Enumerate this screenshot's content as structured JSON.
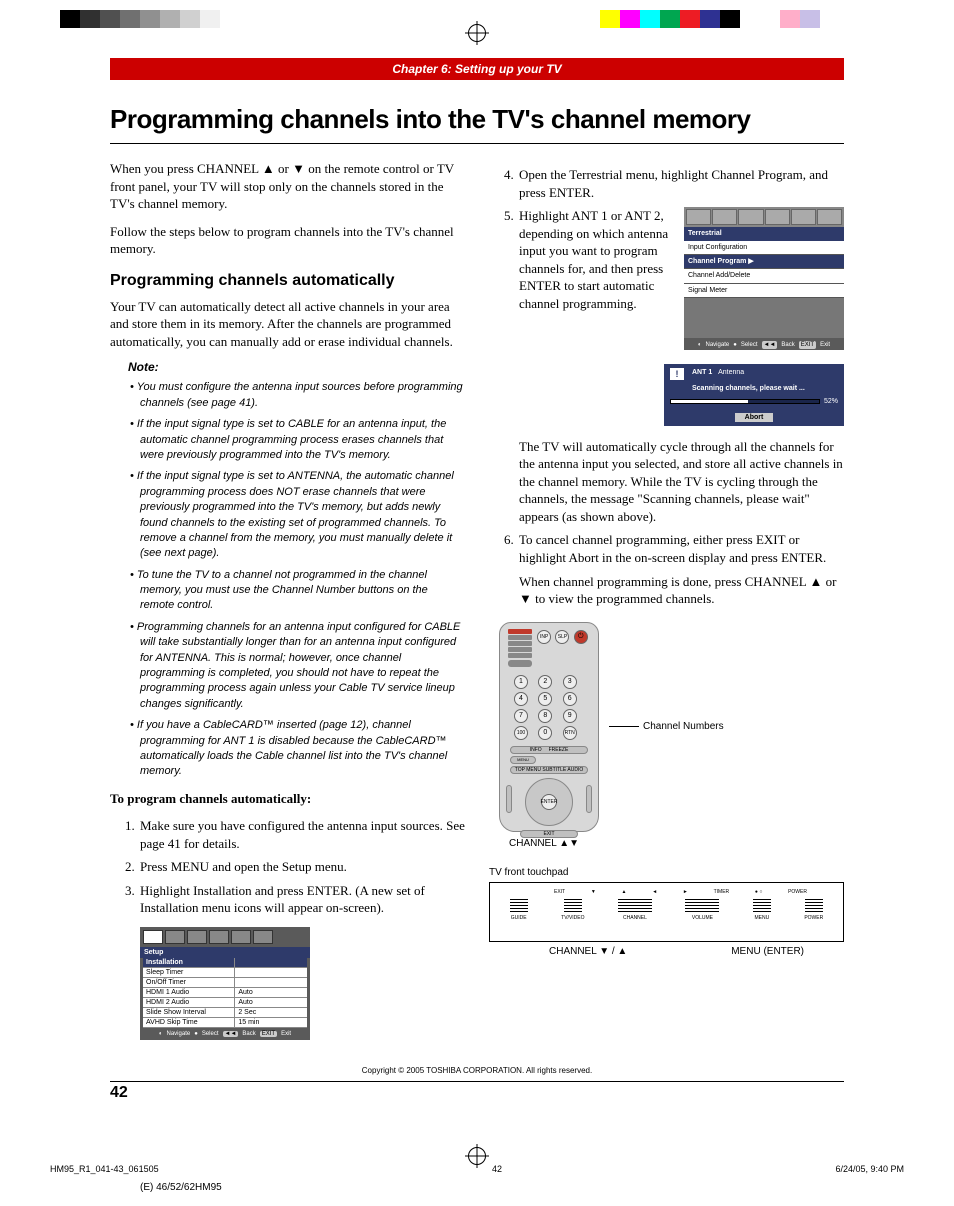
{
  "color_bar": [
    "#000",
    "#303030",
    "#505050",
    "#707070",
    "#909090",
    "#b0b0b0",
    "#d0d0d0",
    "#f0f0f0",
    "#fff",
    "#fff",
    "#fff",
    "#fff",
    "#fff",
    "#fff",
    "#fff",
    "#fff",
    "#fff",
    "#fff",
    "#fff",
    "#fff",
    "#fff",
    "#fff",
    "#fff",
    "#fff",
    "#fff",
    "#fff",
    "#fff",
    "#ffff00",
    "#ff00ff",
    "#00ffff",
    "#00a650",
    "#ed1c24",
    "#2e3192",
    "#000",
    "#fff",
    "#fff",
    "#ffaec9",
    "#c8bfe7",
    "#fff"
  ],
  "chapter": "Chapter 6: Setting up your TV",
  "h1": "Programming channels into the TV's channel memory",
  "left": {
    "p1": "When you press CHANNEL ▲ or ▼ on the remote control or TV front panel, your TV will stop only on the channels stored in the TV's channel memory.",
    "p2": "Follow the steps below to program channels into the TV's channel memory.",
    "h2": "Programming channels automatically",
    "p3": "Your TV can automatically detect all active channels in your area and store them in its memory. After the channels are programmed automatically, you can manually add or erase individual channels.",
    "note_head": "Note:",
    "notes": [
      "You must configure the antenna input sources before programming channels (see page 41).",
      "If the input signal type is set to CABLE for an antenna input, the automatic channel programming process erases channels that were previously programmed into the TV's memory.",
      "If the input signal type is set to ANTENNA, the automatic channel programming process does NOT erase channels that were previously programmed into the TV's memory, but adds newly found channels to the existing set of programmed channels. To remove a channel from the memory, you must manually delete it (see next page).",
      "To tune the TV to a channel not programmed in the channel memory, you must use the Channel Number buttons on the remote control.",
      "Programming channels for an antenna input configured for CABLE will take substantially longer than for an antenna input configured for ANTENNA. This is normal; however, once channel programming is completed, you should not have to repeat the programming process again unless your Cable TV service lineup changes significantly.",
      "If you have a CableCARD™ inserted (page 12), channel programming for ANT 1 is disabled because the CableCARD™ automatically loads the Cable channel list into the TV's channel memory."
    ],
    "steps_head": "To program channels automatically:",
    "steps": [
      "Make sure you have configured the antenna input sources. See page 41 for details.",
      "Press MENU and open the Setup menu.",
      "Highlight Installation and press ENTER. (A new set of Installation menu icons will appear on-screen)."
    ],
    "osd": {
      "title": "Setup",
      "rows": [
        {
          "l": "Installation",
          "r": "",
          "hl": true
        },
        {
          "l": "Sleep Timer",
          "r": ""
        },
        {
          "l": "On/Off Timer",
          "r": ""
        },
        {
          "l": "HDMI 1 Audio",
          "r": "Auto"
        },
        {
          "l": "HDMI 2 Audio",
          "r": "Auto"
        },
        {
          "l": "Slide Show Interval",
          "r": "2 Sec"
        },
        {
          "l": "AVHD Skip Time",
          "r": "15 min"
        }
      ],
      "foot": [
        "Navigate",
        "Select",
        "Back",
        "Exit"
      ]
    }
  },
  "right": {
    "step4": "Open the Terrestrial menu, highlight Channel Program, and press ENTER.",
    "step5": "Highlight ANT 1 or ANT 2, depending on which antenna input you want to program channels for, and then press ENTER to start automatic channel programming.",
    "terr": {
      "title": "Terrestrial",
      "rows": [
        {
          "t": "Input Configuration",
          "hl": false
        },
        {
          "t": "Channel Program ▶",
          "hl": true
        },
        {
          "t": "Channel Add/Delete",
          "hl": false
        },
        {
          "t": "Signal Meter",
          "hl": false
        }
      ],
      "foot": [
        "Navigate",
        "Select",
        "Back",
        "Exit"
      ]
    },
    "scan": {
      "ant": "ANT 1",
      "antenna": "Antenna",
      "msg": "Scanning channels, please wait ...",
      "pct": "52%",
      "abort": "Abort"
    },
    "p_after5": "The TV will automatically cycle through all the channels for the antenna input you selected, and store all active channels in the channel memory. While the TV is cycling through the channels, the message \"Scanning channels, please wait\" appears (as shown above).",
    "step6": "To cancel channel programming, either press EXIT or highlight Abort in the on-screen display and press ENTER.",
    "step6b": "When channel programming is done, press CHANNEL ▲ or ▼ to view the programmed channels.",
    "remote_lbl": "Channel Numbers",
    "remote_caption": "CHANNEL ▲▼",
    "touchpad_lbl": "TV front touchpad",
    "tp_buttons": [
      "GUIDE",
      "TV/VIDEO",
      "CHANNEL",
      "VOLUME",
      "MENU",
      "POWER"
    ],
    "tp_top": [
      "EXIT",
      "▼",
      "▲",
      "◄",
      "►",
      "TIMER",
      "POWER"
    ],
    "tp_cap_l": "CHANNEL ▼  /  ▲",
    "tp_cap_r": "MENU (ENTER)"
  },
  "copyright": "Copyright © 2005 TOSHIBA CORPORATION. All rights reserved.",
  "page_num": "42",
  "print_foot": {
    "l": "HM95_R1_041-43_061505",
    "c": "42",
    "r": "6/24/05, 9:40 PM"
  },
  "model": "(E) 46/52/62HM95"
}
